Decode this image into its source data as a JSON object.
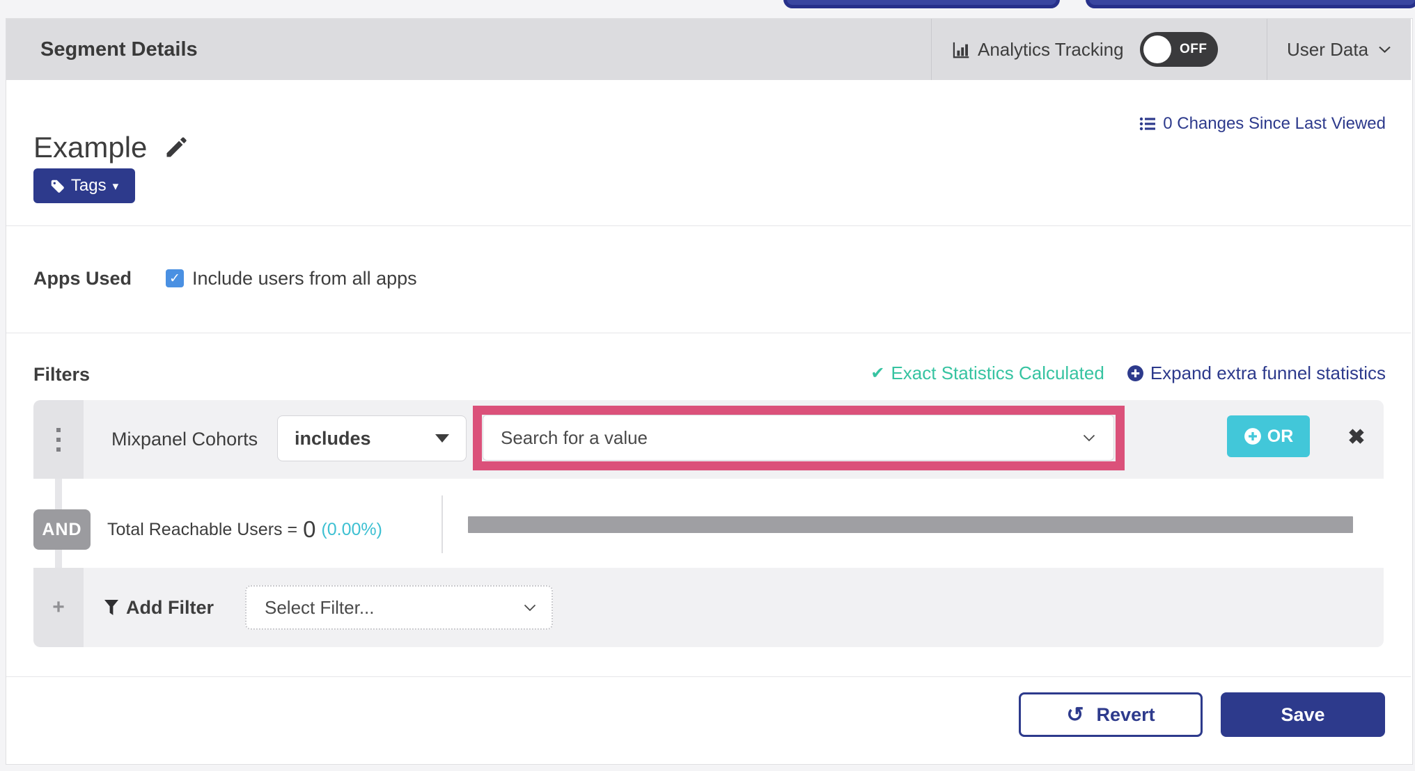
{
  "header": {
    "title": "Segment Details",
    "analytics_tracking_label": "Analytics Tracking",
    "toggle_state": "OFF",
    "user_data_label": "User Data"
  },
  "segment": {
    "name": "Example",
    "changes_link": "0 Changes Since Last Viewed",
    "tags_button_label": "Tags"
  },
  "apps_used": {
    "label": "Apps Used",
    "checkbox_label": "Include users from all apps",
    "checkbox_checked": true
  },
  "filters": {
    "heading": "Filters",
    "exact_stats_label": "Exact Statistics Calculated",
    "expand_stats_label": "Expand extra funnel statistics",
    "row": {
      "field": "Mixpanel Cohorts",
      "operator": "includes",
      "value_placeholder": "Search for a value",
      "or_button_label": "OR"
    },
    "and_label": "AND",
    "total_reachable": {
      "label": "Total Reachable Users =",
      "count": "0",
      "percent": "(0.00%)"
    },
    "add_filter_label": "Add Filter",
    "select_filter_placeholder": "Select Filter..."
  },
  "footer": {
    "revert_label": "Revert",
    "save_label": "Save"
  },
  "icons": {
    "check": "✔",
    "checkbox_check": "✓",
    "close": "✖",
    "revert": "↺",
    "caret_down": "▾",
    "plus": "+"
  },
  "colors": {
    "navy": "#2d3a8c",
    "teal_or": "#42c7d9",
    "green_exact": "#36c3a1",
    "cyan_percent": "#3dc0d2",
    "checkbox_blue": "#4a90e2",
    "highlight_pink": "#db517a",
    "header_gray": "#dcdcdf",
    "row_gray": "#f1f1f3"
  }
}
